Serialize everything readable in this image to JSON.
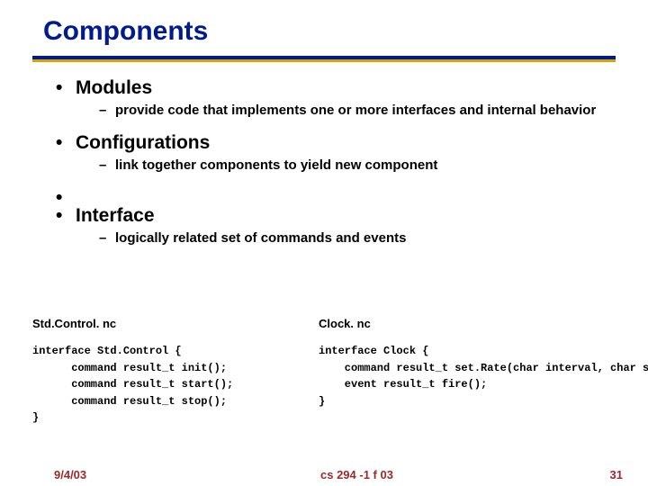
{
  "title": "Components",
  "bullets": {
    "b1": {
      "head": "Modules",
      "sub": "provide code that implements one or more interfaces and internal behavior"
    },
    "b2": {
      "head": "Configurations",
      "sub": "link together components to yield new component"
    },
    "b3": {
      "head": "Interface",
      "sub": "logically related set of commands and events"
    }
  },
  "code": {
    "left": {
      "filename": "Std.Control. nc",
      "body": "interface Std.Control {\n      command result_t init();\n      command result_t start();\n      command result_t stop();\n}"
    },
    "right": {
      "filename": "Clock. nc",
      "body": "interface Clock {\n    command result_t set.Rate(char interval, char scale);\n    event result_t fire();\n}"
    }
  },
  "footer": {
    "date": "9/4/03",
    "course": "cs 294 -1 f 03",
    "page": "31"
  }
}
